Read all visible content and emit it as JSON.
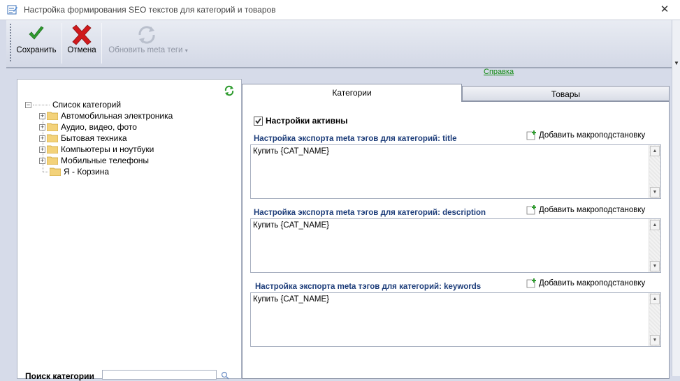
{
  "window": {
    "title": "Настройка формирования SEO текстов для категорий и товаров",
    "close_glyph": "✕"
  },
  "toolbar": {
    "save_label": "Сохранить",
    "cancel_label": "Отмена",
    "update_meta_label": "Обновить meta теги",
    "update_meta_arrow": "▾"
  },
  "help_link": "Справка",
  "tree": {
    "root": "Список категорий",
    "expander_minus": "−",
    "expander_plus": "+",
    "items": [
      {
        "label": "Автомобильная электроника",
        "expandable": true
      },
      {
        "label": "Аудио, видео, фото",
        "expandable": true
      },
      {
        "label": "Бытовая техника",
        "expandable": true
      },
      {
        "label": "Компьютеры и ноутбуки",
        "expandable": true
      },
      {
        "label": "Мобильные телефоны",
        "expandable": true
      },
      {
        "label": "Я - Корзина",
        "expandable": false
      }
    ]
  },
  "search": {
    "label": "Поиск категории"
  },
  "tabs": [
    {
      "label": "Категории",
      "active": true
    },
    {
      "label": "Товары",
      "active": false
    }
  ],
  "settings": {
    "active_label": "Настройки активны",
    "active_checked": true,
    "add_macro_label": "Добавить макроподстановку",
    "sections": [
      {
        "title": "Настройка экспорта meta тэгов для категорий: title",
        "value": "Купить {CAT_NAME}"
      },
      {
        "title": "Настройка экспорта meta тэгов для категорий: description",
        "value": "Купить {CAT_NAME}"
      },
      {
        "title": "Настройка экспорта meta тэгов для категорий: keywords",
        "value": "Купить {CAT_NAME}"
      }
    ]
  },
  "scroll_glyphs": {
    "up": "▲",
    "down": "▼"
  },
  "colors": {
    "accent_green": "#2e9b2e",
    "cancel_red": "#d0191c",
    "section_title": "#1d3d7a",
    "link_green": "#118a11"
  }
}
